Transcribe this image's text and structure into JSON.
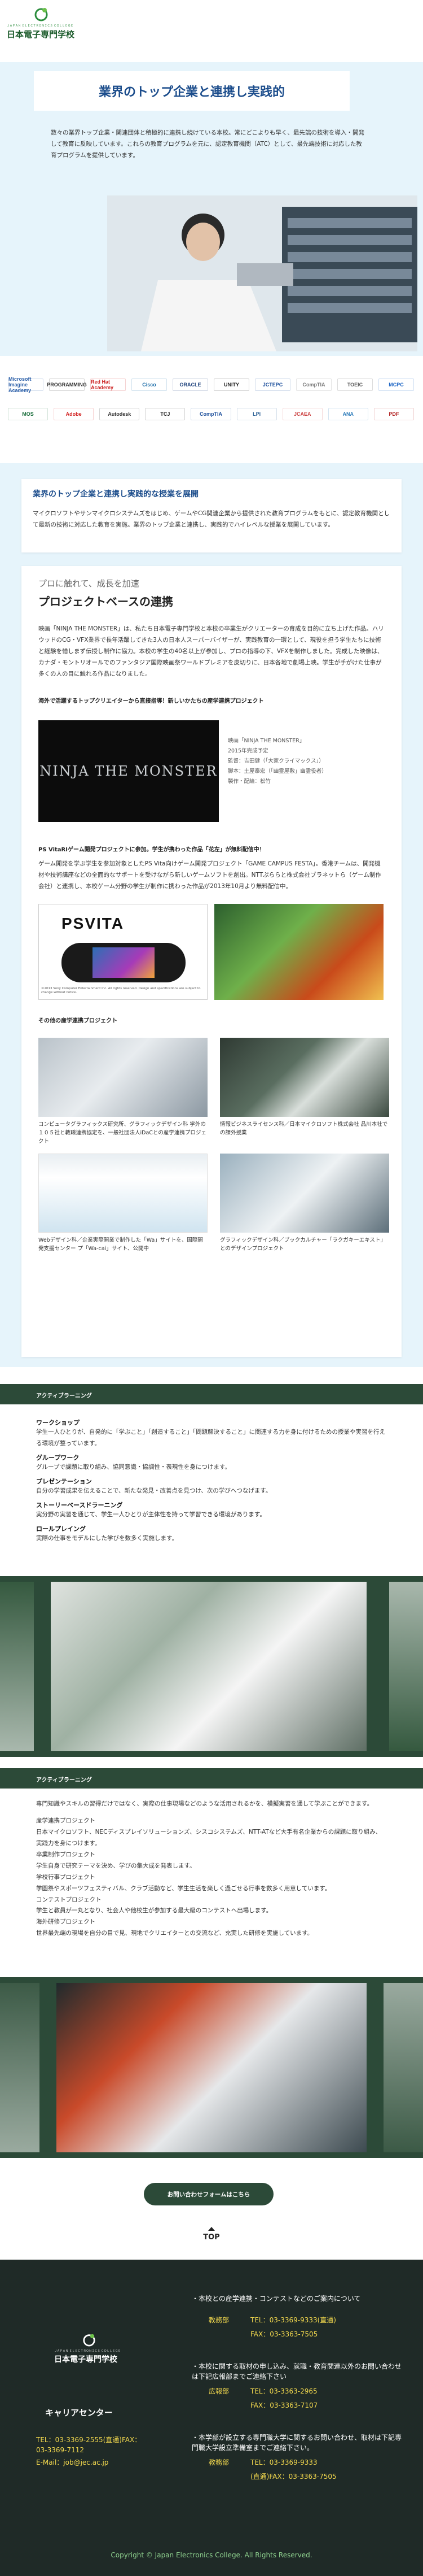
{
  "header": {
    "logo_tagline": "ＪＡＰＡＮ ＥＬＥＣＴＲＯＮＩＣＳ ＣＯＬＬＥＧＥ",
    "logo_name": "日本電子専門学校",
    "menu_icon": "hamburger-menu-icon",
    "mail_icon": "mail-icon"
  },
  "hero": {
    "title": "業界のトップ企業と連携し実践的",
    "body": "数々の業界トップ企業・関連団体と積極的に連携し続けている本校。常にどこよりも早く、最先端の技術を導入・開発して教育に反映しています。これらの教育プログラムを元に、認定教育機関（ATC）として、最先端技術に対応した教育プログラムを提供しています。"
  },
  "partner_logos": [
    {
      "label": "Microsoft Imagine Academy",
      "color": "#2b5fa8"
    },
    {
      "label": "PROGRAMMING",
      "color": "#333333"
    },
    {
      "label": "Red Hat Academy",
      "color": "#cc2222"
    },
    {
      "label": "Cisco",
      "color": "#1b6ca8"
    },
    {
      "label": "ORACLE",
      "color": "#1a3e7a"
    },
    {
      "label": "UNITY",
      "color": "#222222"
    },
    {
      "label": "JCTEPC",
      "color": "#1b4e9b"
    },
    {
      "label": "CompTIA",
      "color": "#777777"
    },
    {
      "label": "TOEIC",
      "color": "#555555"
    },
    {
      "label": "MCPC",
      "color": "#1a63c4"
    },
    {
      "label": "MOS",
      "color": "#1a6e3c"
    },
    {
      "label": "Adobe",
      "color": "#d21e1e"
    },
    {
      "label": "Autodesk",
      "color": "#333333"
    },
    {
      "label": "TCJ",
      "color": "#222222"
    },
    {
      "label": "CompTIA",
      "color": "#1b4e9b"
    },
    {
      "label": "LPI",
      "color": "#336699"
    },
    {
      "label": "JCAEA",
      "color": "#cc4444"
    },
    {
      "label": "ANA",
      "color": "#2b7bb9"
    },
    {
      "label": "PDF",
      "color": "#b22222"
    }
  ],
  "intro_card": {
    "title": "業界のトップ企業と連携し実践的な授業を展開",
    "body": "マイクロソフトやサンマイクロシステムズをはじめ、ゲームやCG関連企業から提供された教育プログラムをもとに、認定教育機関として最新の技術に対応した教育を実施。業界のトップ企業と連携し、実践的でハイレベルな授業を展開しています。"
  },
  "project_section": {
    "lead": "プロに触れて、成長を加速",
    "title": "プロジェクトベースの連携",
    "body": "映画「NINJA THE MONSTER」は、私たち日本電子専門学校と本校の卒業生がクリエーターの育成を目的に立ち上げた作品。ハリウッドのCG・VFX業界で長年活躍してきた3人の日本人スーパーバイザーが、実践教育の一環として、現役を担う学生たちに技術と経験を惜しまず伝授し制作に協力。本校の学生の40名以上が参加し、プロの指導の下、VFXを制作しました。完成した映像は、カナダ・モントリオールでのファンタジア国際映画祭ワールドプレミアを皮切りに、日本各地で劇場上映。学生が手がけた仕事が多くの人の目に触れる作品になりました。",
    "sub_heading": "海外で活躍するトップクリエイターから直接指導！新しいかたちの産学連携プロジェクト",
    "movie_title_art": "NINJA THE MONSTER",
    "movie_info": [
      "映画「NINJA THE MONSTER」",
      "2015年完成予定",
      "監督：吉田健（「大家クライマックス」）",
      "脚本：土屋泰宏（「幽霊屋敷」幽霊役者）",
      "製作・配給：松竹"
    ],
    "ps_heading": "PS VitaRIゲーム開発プロジェクトに参加。学生が携わった作品「花左」が無料配信中！",
    "ps_body": "ゲーム開発を学ぶ学生を参加対象としたPS Vita向けゲーム開発プロジェクト「GAME CAMPUS FESTA」。香港チームは、開発機材や技術講座などの全面的なサポートを受けながら新しいゲームソフトを創出。NTTぷららと株式会社ブラネットら（ゲーム制作会社）と連携し、本校ゲーム分野の学生が制作に携わった作品が2013年10月より無料配信中。",
    "ps_logo": "PSVITA",
    "ps_caption": "©2013 Sony Computer Entertainment Inc. All rights reserved. Design and specifications are subject to change without notice.",
    "other_heading": "その他の産学連携プロジェクト",
    "other_projects": [
      {
        "caption": "コンピュータグラフィックス研究所、グラフィックデザイン科 学外の１０５社と教職連携協定を、一般社団法人iDaCとの産学連携プロジェクト"
      },
      {
        "caption": "情報ビジネスライセンス科／日本マイクロソフト株式会社 品川本社での課外授業"
      },
      {
        "caption": "Webデザイン科／企業実際開業で制作した「Wa」サイトを、国際開発支援センター プ「Wa-cai」サイト、公開中"
      },
      {
        "caption": "グラフィックデザイン科／ブックカルチャー「ラクガキーエキスト」とのデザインプロジェクト"
      }
    ]
  },
  "active_learning_1": {
    "section_label": "アクティブラーニング",
    "items": [
      {
        "title": "ワークショップ",
        "desc": "学生一人ひとりが、自発的に「学ぶこと」「創造すること」「問題解決すること」に関連する力を身に付けるための授業や実習を行える環境が整っています。"
      },
      {
        "title": "グループワーク",
        "desc": "グループで課題に取り組み、協同意識・協調性・表現性を身につけます。"
      },
      {
        "title": "プレゼンテーション",
        "desc": "自分の学習成果を伝えることで、新たな発見・改善点を見つけ、次の学びへつなげます。"
      },
      {
        "title": "ストーリーベースドラーニング",
        "desc": "実分野の実習を通じて、学生一人ひとりが主体性を持って学習できる環境があります。"
      },
      {
        "title": "ロールプレイング",
        "desc": "実際の仕事をモデルにした学びを数多く実施します。"
      }
    ]
  },
  "active_learning_2": {
    "section_label": "アクティブラーニング",
    "intro": "専門知識やスキルの習得だけではなく、実際の仕事現場などのような活用されるかを、模擬実習を通して学ぶことができます。",
    "items": [
      {
        "title": "産学連携プロジェクト",
        "desc": "日本マイクロソフト、NECディスプレイソリューションズ、シスコシステムズ、NTT-ATなど大手有名企業からの課題に取り組み、実践力を身につけます。"
      },
      {
        "title": "卒業制作プロジェクト",
        "desc": "学生自身で研究テーマを決め、学びの集大成を発表します。"
      },
      {
        "title": "学校行事プロジェクト",
        "desc": "学園祭やスポーツフェスティバル、クラブ活動など、学生生活を楽しく過ごせる行事を数多く用意しています。"
      },
      {
        "title": "コンテストプロジェクト",
        "desc": "学生と教員が一丸となり、社会人や他校生が参加する最大級のコンテストへ出場します。"
      },
      {
        "title": "海外研修プロジェクト",
        "desc": "世界最先端の現場を自分の目で見、現地でクリエイターとの交流など、充実した研修を実施しています。"
      }
    ]
  },
  "cta": {
    "button_label": "お問い合わせフォームはこちら",
    "top_label": "TOP"
  },
  "footer": {
    "logo_tagline": "ＪＡＰＡＮ ＥＬＥＣＴＲＯＮＩＣＳ ＣＯＬＬＥＧＥ",
    "logo_name": "日本電子専門学校",
    "career_center": "キャリアセンター",
    "career_tel": "TEL：03-3369-2555(直通)FAX：",
    "career_fax": "03-3369-7112",
    "career_email": "E-Mail：job@jec.ac.jp",
    "blocks": [
      {
        "title": "・本校との産学連携・コンテストなどのご案内について",
        "rows": [
          {
            "k": "教務部",
            "v": "TEL：03-3369-9333(直通)"
          },
          {
            "k": "",
            "v": "FAX：03-3363-7505"
          }
        ]
      },
      {
        "title": "・本校に関する取材の申し込み、就職・教育関連以外のお問い合わせは下記広報部までご連絡下さい",
        "rows": [
          {
            "k": "広報部",
            "v": "TEL：03-3363-2965"
          },
          {
            "k": "",
            "v": "FAX：03-3363-7107"
          }
        ]
      },
      {
        "title": "・本学部が設立する専門職大学に関するお問い合わせ、取材は下記専門職大学設立準備室までご連絡下さい。",
        "rows": [
          {
            "k": "教務部",
            "v": "TEL：03-3369-9333"
          },
          {
            "k": "",
            "v": "(直通)FAX：03-3363-7505"
          }
        ]
      }
    ],
    "copyright": "Copyright © Japan Electronics College. All Rights Reserved."
  },
  "colors": {
    "brand_green": "#2a8c3c",
    "dark_green": "#2c4a38",
    "hero_bg": "#e6f4fb",
    "footer_bg": "#1f2a27",
    "footer_text": "#f3d94e"
  }
}
